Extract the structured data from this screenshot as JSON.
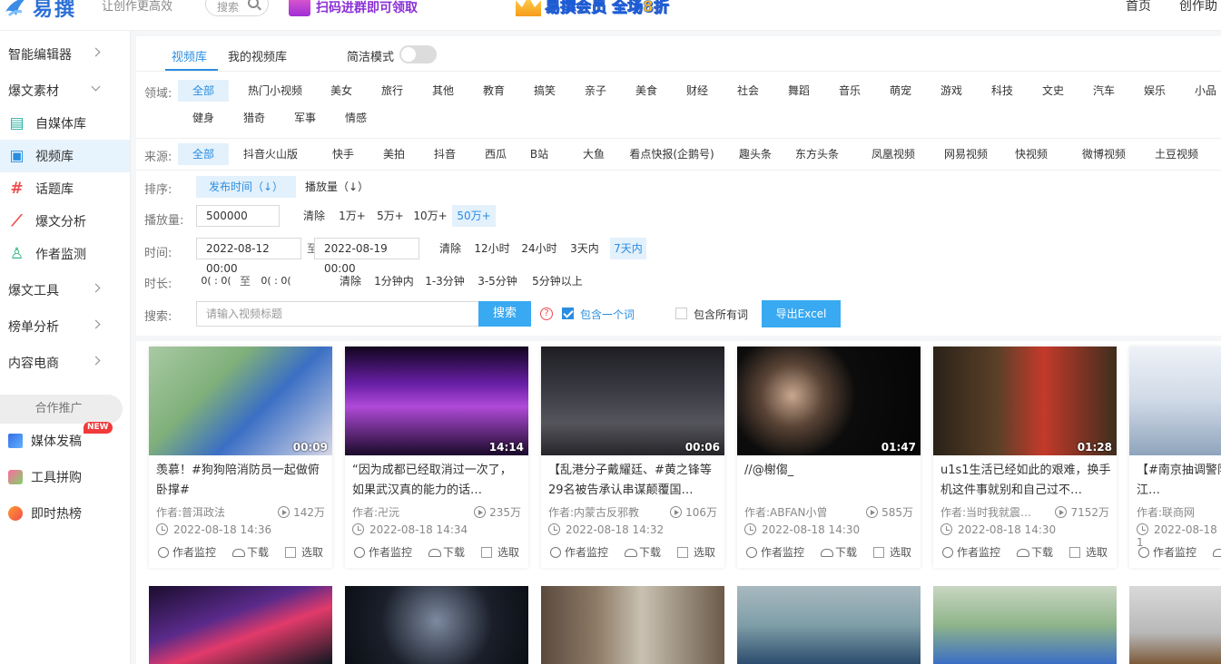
{
  "header": {
    "logo_text": "易撰",
    "slogan": "让创作更高效",
    "search_placeholder": "搜索",
    "banner_promo": "扫码进群即可领取",
    "banner_vip": "易撰会员 全场8折",
    "nav": [
      "首页",
      "创作助"
    ]
  },
  "sidebar": {
    "sections": [
      {
        "label": "智能编辑器",
        "expanded": false
      },
      {
        "label": "爆文素材",
        "expanded": true
      },
      {
        "label": "爆文工具",
        "expanded": false
      },
      {
        "label": "榜单分析",
        "expanded": false
      },
      {
        "label": "内容电商",
        "expanded": false
      }
    ],
    "subitems": [
      {
        "label": "自媒体库",
        "icon": "document-icon"
      },
      {
        "label": "视频库",
        "icon": "video-icon",
        "active": true
      },
      {
        "label": "话题库",
        "icon": "hash-icon"
      },
      {
        "label": "爆文分析",
        "icon": "chart-icon"
      },
      {
        "label": "作者监测",
        "icon": "user-add-icon"
      }
    ],
    "coop_label": "合作推广",
    "extras": [
      {
        "label": "媒体发稿",
        "badge": "NEW"
      },
      {
        "label": "工具拼购"
      },
      {
        "label": "即时热榜"
      }
    ]
  },
  "tabs": [
    "视频库",
    "我的视频库"
  ],
  "simple_mode_label": "简洁模式",
  "filters": {
    "domain_label": "领域:",
    "domains_row1": [
      "全部",
      "热门小视频",
      "美女",
      "旅行",
      "其他",
      "教育",
      "搞笑",
      "亲子",
      "美食",
      "财经",
      "社会",
      "舞蹈",
      "音乐",
      "萌宠",
      "游戏",
      "科技",
      "文史",
      "汽车",
      "娱乐",
      "小品"
    ],
    "domains_row2": [
      "健身",
      "猎奇",
      "军事",
      "情感"
    ],
    "source_label": "来源:",
    "sources": [
      "全部",
      "抖音火山版",
      "快手",
      "美拍",
      "抖音",
      "西瓜",
      "B站",
      "大鱼",
      "看点快报(企鹅号)",
      "趣头条",
      "东方头条",
      "凤凰视频",
      "网易视频",
      "快视频",
      "微博视频",
      "土豆视频"
    ],
    "sort_label": "排序:",
    "sorts": [
      "发布时间（↓）",
      "播放量（↓）"
    ],
    "plays_label": "播放量:",
    "plays_value": "500000",
    "plays_opts": [
      "清除",
      "1万+",
      "5万+",
      "10万+",
      "50万+"
    ],
    "time_label": "时间:",
    "time_start": "2022-08-12 00:00",
    "time_to": "至",
    "time_end": "2022-08-19 00:00",
    "time_opts": [
      "清除",
      "12小时",
      "24小时",
      "3天内",
      "7天内"
    ],
    "duration_label": "时长:",
    "dur_start": "0( : 0(",
    "dur_to": "至",
    "dur_end": "0( : 0(",
    "dur_opts": [
      "清除",
      "1分钟内",
      "1-3分钟",
      "3-5分钟",
      "5分钟以上"
    ],
    "search_label": "搜索:",
    "search_placeholder": "请输入视频标题",
    "search_button": "搜索",
    "help": "?",
    "contain_one": "包含一个词",
    "contain_all": "包含所有词",
    "export_button": "导出Excel"
  },
  "cards": [
    {
      "title": "羡慕！#狗狗陪消防员一起做俯卧撑#",
      "author": "作者:普洱政法",
      "views": "142万",
      "time": "2022-08-18 14:36",
      "duration": "00:09"
    },
    {
      "title": "“因为成都已经取消过一次了，如果武汉真的能力的话…",
      "author": "作者:卍沅",
      "views": "235万",
      "time": "2022-08-18 14:34",
      "duration": "14:14"
    },
    {
      "title": "【乱港分子戴耀廷、#黄之锋等29名被告承认串谋颠覆国…",
      "author": "作者:内蒙古反邪教",
      "views": "106万",
      "time": "2022-08-18 14:32",
      "duration": "00:06"
    },
    {
      "title": "//@榭㑳_",
      "author": "作者:ABFAN小曾",
      "views": "585万",
      "time": "2022-08-18 14:30",
      "duration": "01:47"
    },
    {
      "title": "u1s1生活已经如此的艰难，换手机这件事就别和自己过不…",
      "author": "作者:当时我就震…",
      "views": "7152万",
      "time": "2022-08-18 14:30",
      "duration": "01:28"
    },
    {
      "title": "【#南京抽调警队秩序##南京江…",
      "author": "作者:联商网",
      "views": "",
      "time": "2022-08-18 1",
      "duration": ""
    }
  ],
  "card_actions": [
    "作者监控",
    "下载",
    "选取"
  ]
}
